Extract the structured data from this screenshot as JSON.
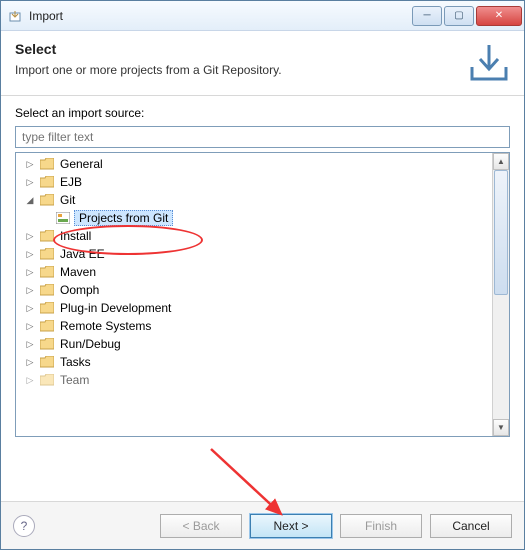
{
  "title": "Import",
  "header": {
    "title": "Select",
    "desc": "Import one or more projects from a Git Repository."
  },
  "label_source": "Select an import source:",
  "filter_placeholder": "type filter text",
  "tree": {
    "items": [
      {
        "label": "General",
        "expanded": false
      },
      {
        "label": "EJB",
        "expanded": false
      },
      {
        "label": "Git",
        "expanded": true,
        "children": [
          {
            "label": "Projects from Git",
            "selected": true
          }
        ]
      },
      {
        "label": "Install",
        "expanded": false
      },
      {
        "label": "Java EE",
        "expanded": false
      },
      {
        "label": "Maven",
        "expanded": false
      },
      {
        "label": "Oomph",
        "expanded": false
      },
      {
        "label": "Plug-in Development",
        "expanded": false
      },
      {
        "label": "Remote Systems",
        "expanded": false
      },
      {
        "label": "Run/Debug",
        "expanded": false
      },
      {
        "label": "Tasks",
        "expanded": false
      },
      {
        "label": "Team",
        "expanded": false
      }
    ]
  },
  "buttons": {
    "back": "< Back",
    "next": "Next >",
    "finish": "Finish",
    "cancel": "Cancel"
  },
  "help": "?"
}
